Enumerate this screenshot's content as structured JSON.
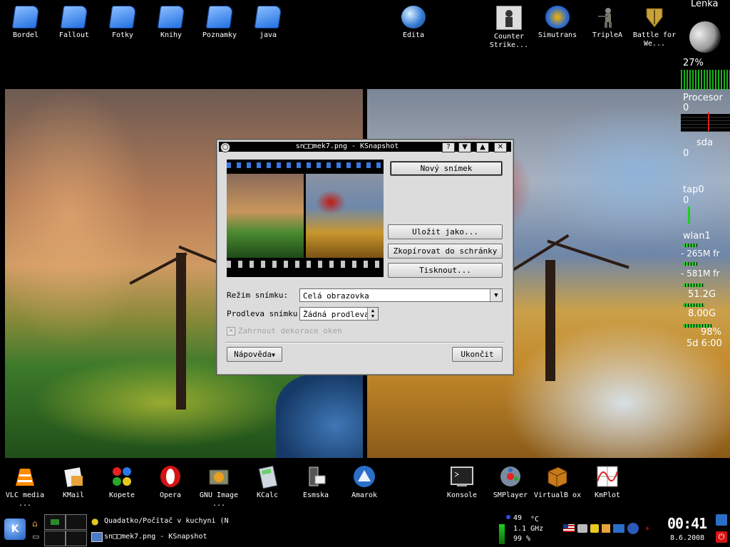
{
  "desktop_icons": [
    {
      "label": "Bordel",
      "icon": "folder-icon"
    },
    {
      "label": "Fallout",
      "icon": "folder-icon"
    },
    {
      "label": "Fotky",
      "icon": "folder-icon"
    },
    {
      "label": "Knihy",
      "icon": "folder-icon"
    },
    {
      "label": "Poznamky",
      "icon": "folder-icon"
    },
    {
      "label": "java",
      "icon": "folder-icon"
    },
    {
      "label": "Edita",
      "icon": "globe-icon"
    },
    {
      "label": "Counter Strike...",
      "icon": "counter-strike-icon"
    },
    {
      "label": "Simutrans",
      "icon": "simutrans-icon"
    },
    {
      "label": "TripleA",
      "icon": "soldier-icon"
    },
    {
      "label": "Battle for We...",
      "icon": "wesnoth-icon"
    }
  ],
  "sysmon": {
    "user": "Lenka",
    "cpu_percent": "27%",
    "processor_label": "Procesor",
    "processor_value": "0",
    "disk_label": "sda",
    "disk_value": "0",
    "tap_label": "tap0",
    "tap_value": "0",
    "wlan_label": "wlan1",
    "wlan_down": "- 265M fr",
    "wlan_up": "- 581M fr",
    "disk1": "51.2G",
    "disk2": "8.00G",
    "battery": "98%",
    "uptime": "5d 6:00"
  },
  "window": {
    "title": "sn□□mek7.png - KSnapshot",
    "new_snapshot": "Nový snímek",
    "save_as": "Uložit jako...",
    "copy_clipboard": "Zkopírovat do schránky",
    "print": "Tisknout...",
    "mode_label": "Režim snímku:",
    "mode_value": "Celá obrazovka",
    "delay_label": "Prodleva snímku:",
    "delay_value": "Žádná prodleva",
    "include_decorations": "Zahrnout dekorace oken",
    "help": "Nápověda",
    "quit": "Ukončit"
  },
  "dock_icons": [
    {
      "label": "VLC media ...",
      "icon": "vlc-icon"
    },
    {
      "label": "KMail",
      "icon": "kmail-icon"
    },
    {
      "label": "Kopete",
      "icon": "kopete-icon"
    },
    {
      "label": "Opera",
      "icon": "opera-icon"
    },
    {
      "label": "GNU Image ...",
      "icon": "gimp-icon"
    },
    {
      "label": "KCalc",
      "icon": "kcalc-icon"
    },
    {
      "label": "Esmska",
      "icon": "esmska-icon"
    },
    {
      "label": "Amarok",
      "icon": "amarok-icon"
    },
    {
      "label": "Konsole",
      "icon": "konsole-icon"
    },
    {
      "label": "SMPlayer",
      "icon": "smplayer-icon"
    },
    {
      "label": "VirtualB ox",
      "icon": "virtualbox-icon"
    },
    {
      "label": "KmPlot",
      "icon": "kmplot-icon"
    }
  ],
  "taskbar": {
    "task1": "Quadatko/Počítač v kuchyni (N",
    "task2": "sn□□mek7.png - KSnapshot",
    "temp": "49",
    "temp_unit": "°C",
    "freq": "1.1 GHz",
    "percent": "99 %",
    "time": "00:41",
    "date": "8.6.2008"
  }
}
